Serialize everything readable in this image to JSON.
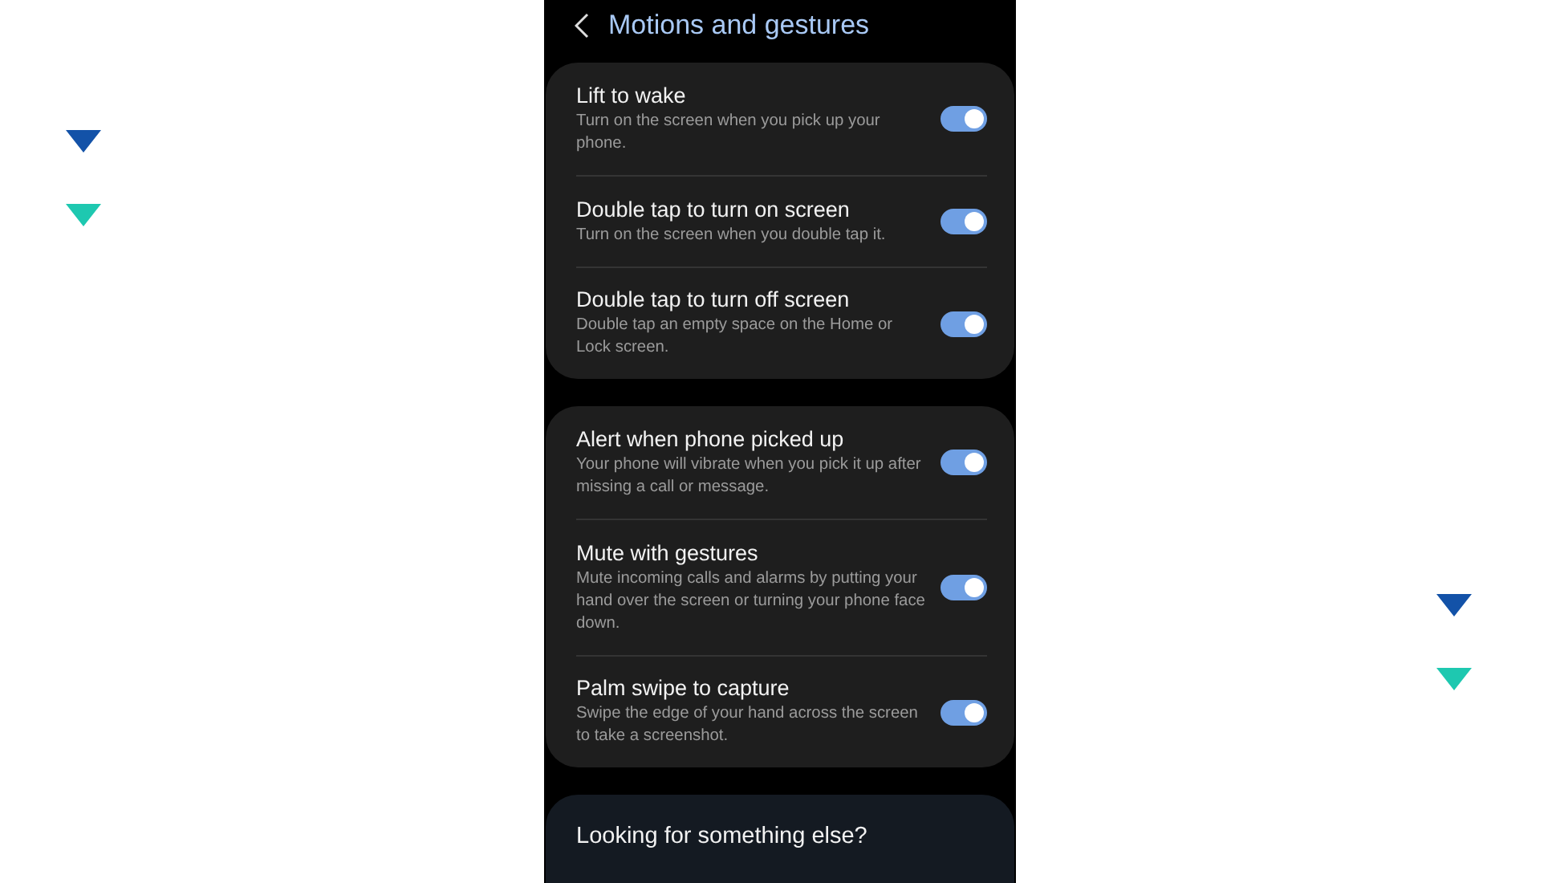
{
  "header": {
    "title": "Motions and gestures"
  },
  "groups": [
    {
      "items": [
        {
          "title": "Lift to wake",
          "subtitle": "Turn on the screen when you pick up your phone.",
          "on": true
        },
        {
          "title": "Double tap to turn on screen",
          "subtitle": "Turn on the screen when you double tap it.",
          "on": true
        },
        {
          "title": "Double tap to turn off screen",
          "subtitle": "Double tap an empty space on the Home or Lock screen.",
          "on": true
        }
      ]
    },
    {
      "items": [
        {
          "title": "Alert when phone picked up",
          "subtitle": "Your phone will vibrate when you pick it up after missing a call or message.",
          "on": true
        },
        {
          "title": "Mute with gestures",
          "subtitle": "Mute incoming calls and alarms by putting your hand over the screen or turning your phone face down.",
          "on": true
        },
        {
          "title": "Palm swipe to capture",
          "subtitle": "Swipe the edge of your hand across the screen to take a screenshot.",
          "on": true
        }
      ]
    }
  ],
  "suggestion": {
    "title": "Looking for something else?"
  }
}
